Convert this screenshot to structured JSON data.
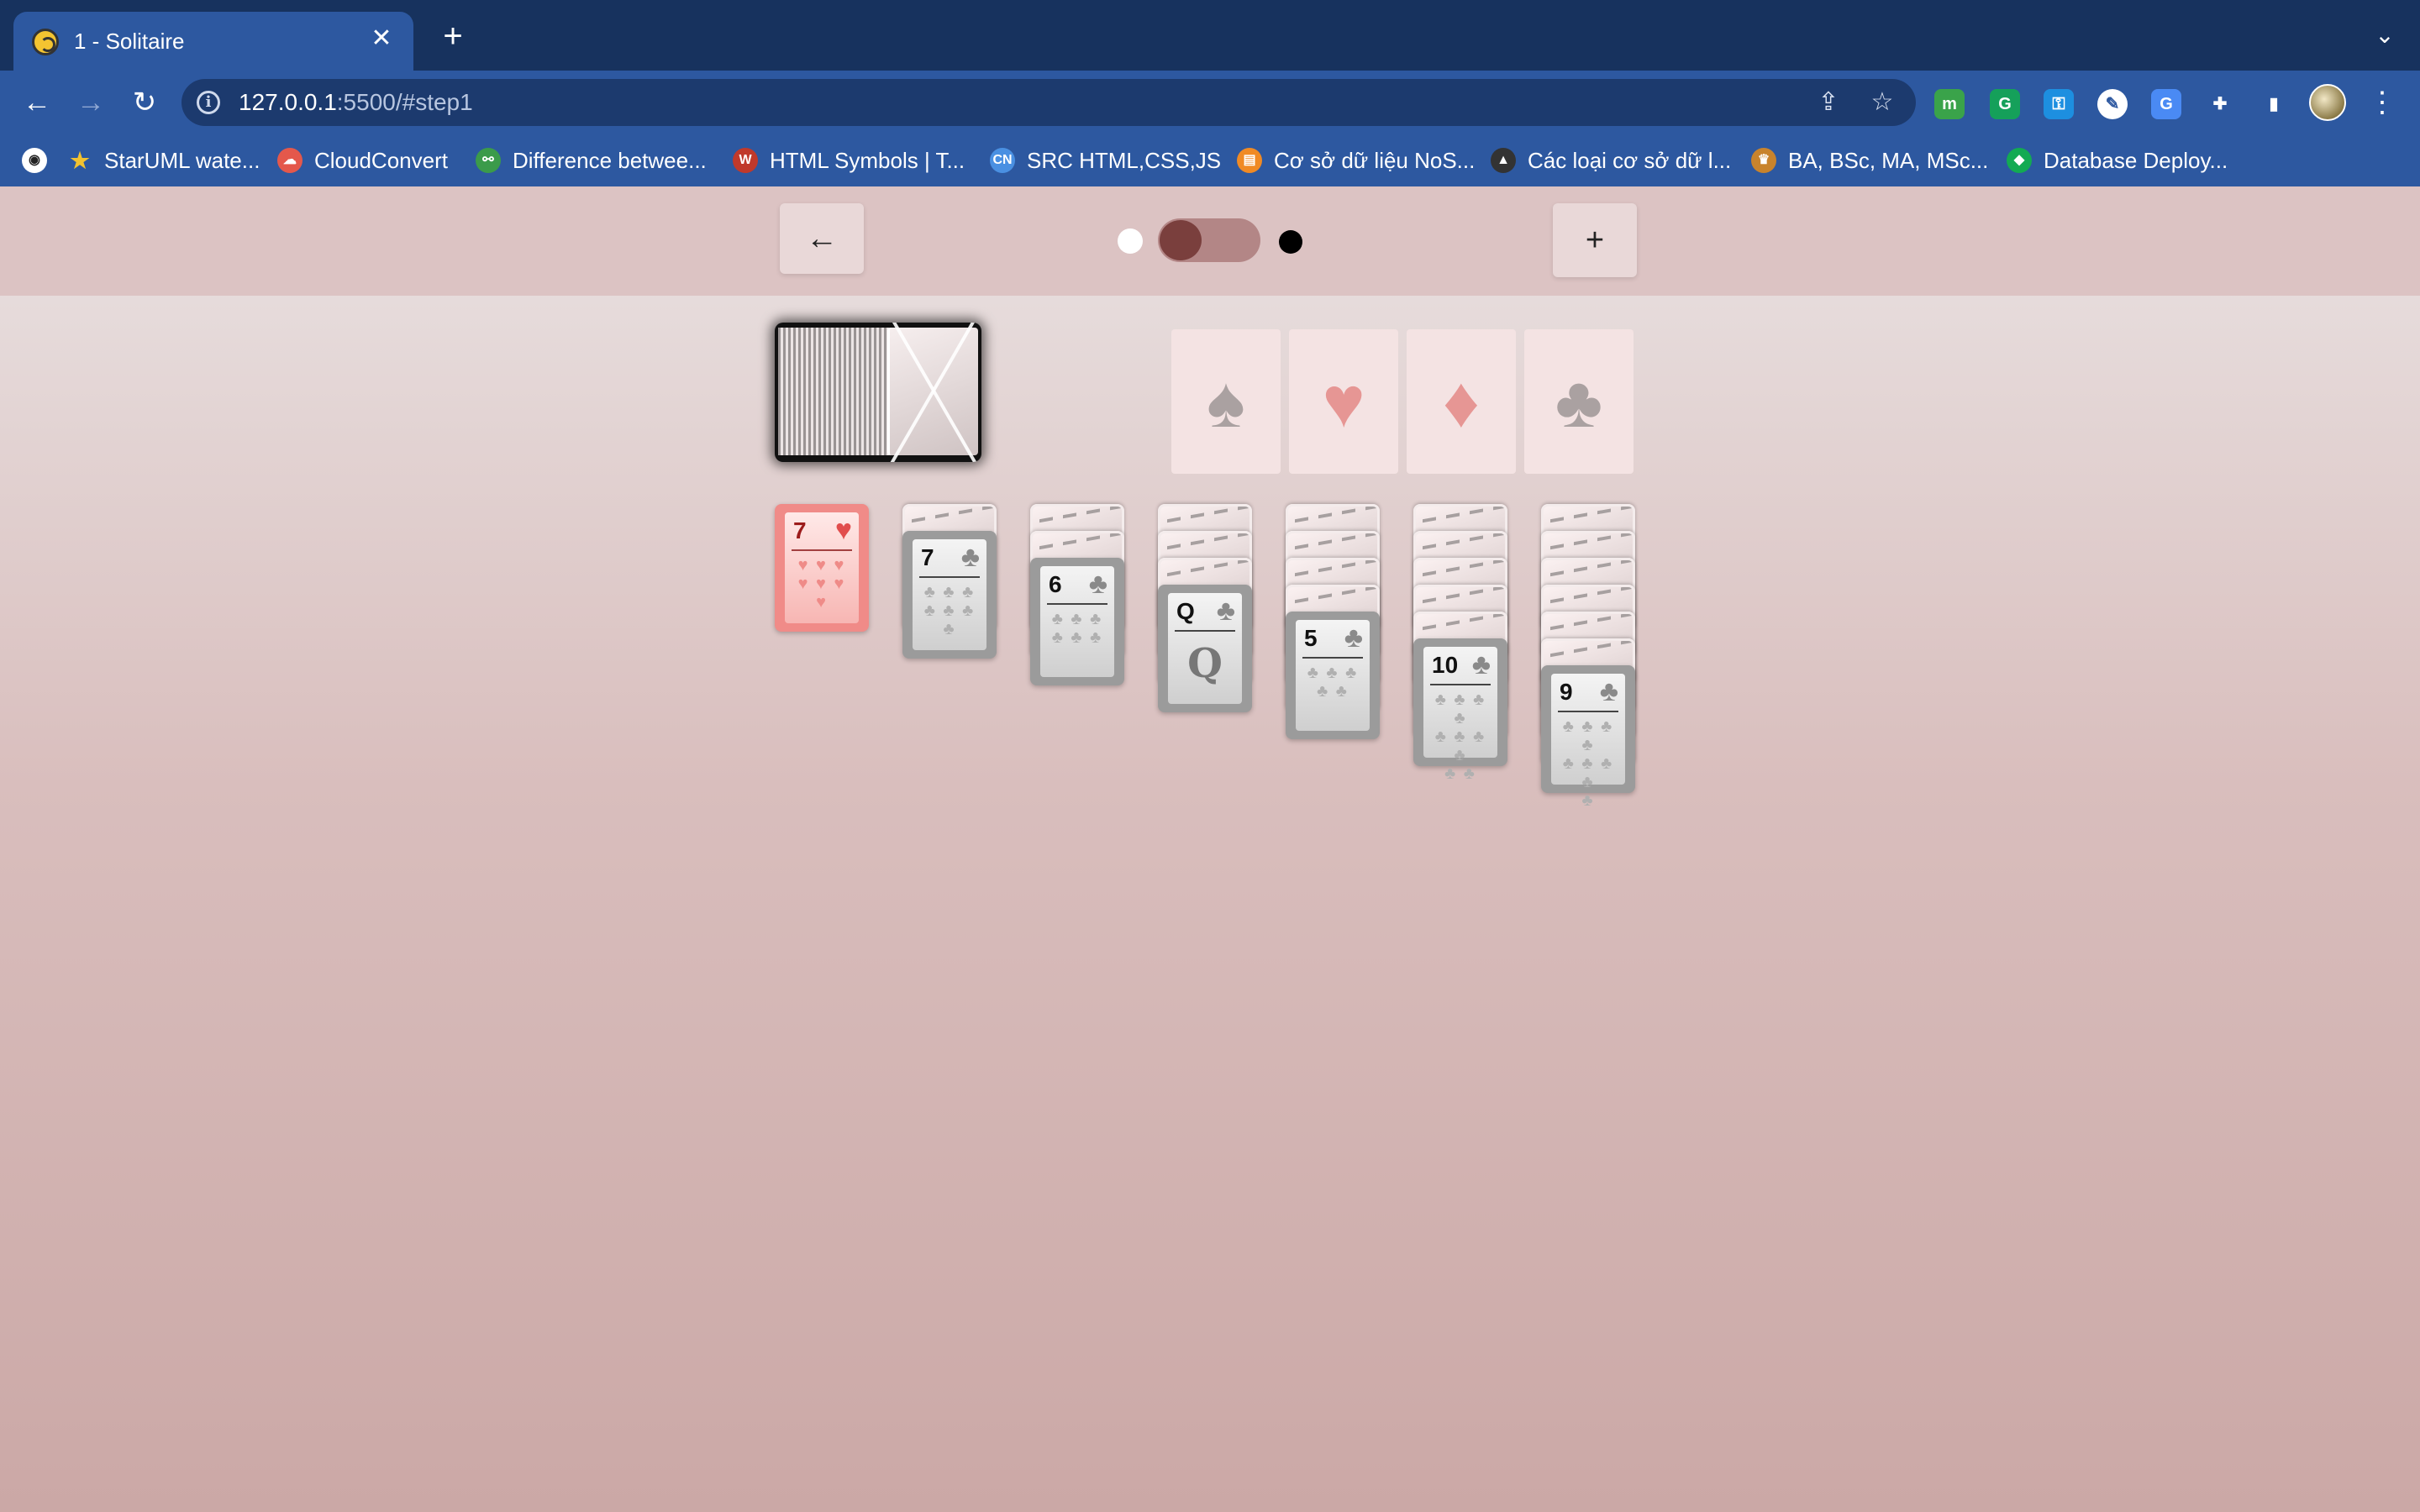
{
  "browser": {
    "tab_title": "1 - Solitaire",
    "tab_close": "✕",
    "new_tab": "+",
    "tab_list": "⌄",
    "url_host": "127.0.0.1",
    "url_path": ":5500/#step1",
    "back": "←",
    "forward": "→",
    "reload": "↻",
    "info": "i",
    "share": "⇪",
    "star": "☆",
    "menu": "⋮",
    "extensions": [
      {
        "name": "evernote-extension-icon",
        "glyph": "m",
        "color": "#3aa34a"
      },
      {
        "name": "grammarly-extension-icon",
        "glyph": "G",
        "color": "#15a05a"
      },
      {
        "name": "password-extension-icon",
        "glyph": "⚿",
        "color": "#1d8fe0"
      },
      {
        "name": "color-picker-extension-icon",
        "glyph": "✎",
        "color": "#ffffff"
      },
      {
        "name": "translate-extension-icon",
        "glyph": "G",
        "color": "#4a8af4"
      },
      {
        "name": "puzzle-extensions-icon",
        "glyph": "✚",
        "color": "transparent"
      },
      {
        "name": "side-panel-icon",
        "glyph": "▮",
        "color": "transparent"
      }
    ],
    "bookmarks": [
      {
        "label": "StarUML wate...",
        "icon": "★",
        "color": "#f2c230"
      },
      {
        "label": "CloudConvert",
        "icon": "☁",
        "color": "#e4584b"
      },
      {
        "label": "Difference betwee...",
        "icon": "⚯",
        "color": "#3b9b4a"
      },
      {
        "label": "HTML Symbols | T...",
        "icon": "W",
        "color": "#c0392b"
      },
      {
        "label": "SRC HTML,CSS,JS",
        "icon": "CN",
        "color": "#4a90e2"
      },
      {
        "label": "Cơ sở dữ liệu NoS...",
        "icon": "▤",
        "color": "#f08a24"
      },
      {
        "label": "Các loại cơ sở dữ l...",
        "icon": "▲",
        "color": "#333333"
      },
      {
        "label": "BA, BSc, MA, MSc...",
        "icon": "♛",
        "color": "#c8832c"
      },
      {
        "label": "Database Deploy...",
        "icon": "◆",
        "color": "#13aa52"
      }
    ]
  },
  "game": {
    "back_button": "←",
    "new_game_button": "+",
    "theme_toggle": {
      "state": "light"
    },
    "foundations": [
      {
        "suit": "♠",
        "color": "#aaa1a1"
      },
      {
        "suit": "♥",
        "color": "#e69694"
      },
      {
        "suit": "♦",
        "color": "#e69694"
      },
      {
        "suit": "♣",
        "color": "#aaa1a1"
      }
    ],
    "tableau": [
      {
        "hidden": 0,
        "top": {
          "rank": "7",
          "suit": "♥",
          "pips": "♥ ♥ ♥\n♥ ♥ ♥\n♥"
        }
      },
      {
        "hidden": 1,
        "top": {
          "rank": "7",
          "suit": "♣",
          "pips": "♣ ♣ ♣\n♣ ♣ ♣\n♣"
        }
      },
      {
        "hidden": 2,
        "top": {
          "rank": "6",
          "suit": "♣",
          "pips": "♣ ♣ ♣\n♣ ♣ ♣"
        }
      },
      {
        "hidden": 3,
        "top": {
          "rank": "Q",
          "suit": "♣",
          "face": "Q"
        }
      },
      {
        "hidden": 4,
        "top": {
          "rank": "5",
          "suit": "♣",
          "pips": "♣ ♣ ♣\n♣ ♣"
        }
      },
      {
        "hidden": 5,
        "top": {
          "rank": "10",
          "suit": "♣",
          "pips": "♣ ♣ ♣ ♣\n♣ ♣ ♣ ♣\n♣ ♣"
        }
      },
      {
        "hidden": 6,
        "top": {
          "rank": "9",
          "suit": "♣",
          "pips": "♣ ♣ ♣ ♣\n♣ ♣ ♣ ♣\n♣"
        }
      }
    ]
  }
}
